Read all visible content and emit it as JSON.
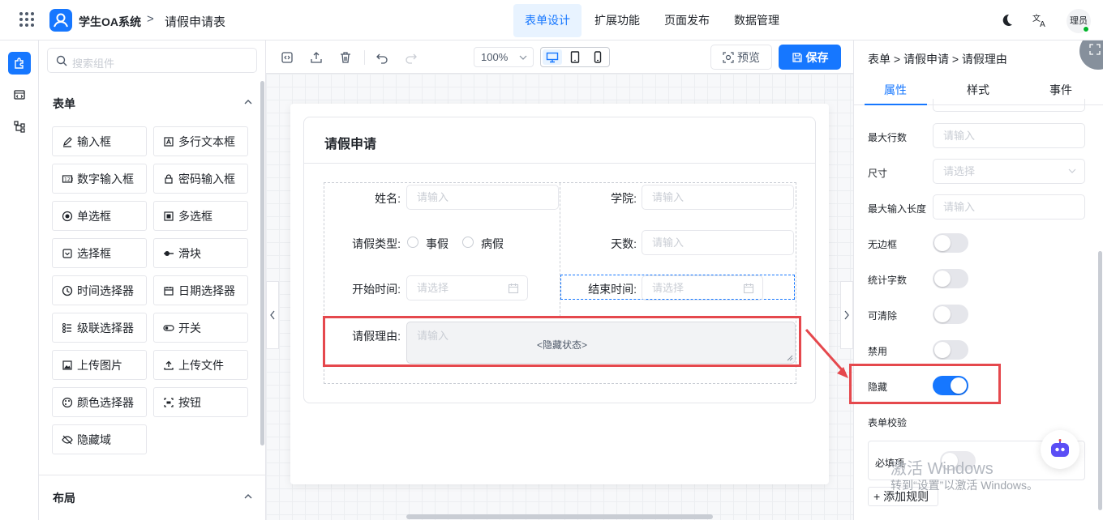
{
  "header": {
    "app_name": "学生OA系统",
    "crumb_sep": ">",
    "form_name": "请假申请表",
    "nav": [
      "表单设计",
      "扩展功能",
      "页面发布",
      "数据管理"
    ],
    "avatar_text": "理员"
  },
  "components": {
    "search_placeholder": "搜索组件",
    "form_section": "表单",
    "layout_section": "布局",
    "items": [
      {
        "label": "输入框",
        "icon": "edit-icon"
      },
      {
        "label": "多行文本框",
        "icon": "textarea-icon"
      },
      {
        "label": "数字输入框",
        "icon": "number-icon"
      },
      {
        "label": "密码输入框",
        "icon": "lock-icon"
      },
      {
        "label": "单选框",
        "icon": "radio-icon"
      },
      {
        "label": "多选框",
        "icon": "checkbox-icon"
      },
      {
        "label": "选择框",
        "icon": "select-icon"
      },
      {
        "label": "滑块",
        "icon": "slider-icon"
      },
      {
        "label": "时间选择器",
        "icon": "clock-icon"
      },
      {
        "label": "日期选择器",
        "icon": "calendar-icon"
      },
      {
        "label": "级联选择器",
        "icon": "cascader-icon"
      },
      {
        "label": "开关",
        "icon": "switch-icon"
      },
      {
        "label": "上传图片",
        "icon": "image-icon"
      },
      {
        "label": "上传文件",
        "icon": "upload-icon"
      },
      {
        "label": "颜色选择器",
        "icon": "palette-icon"
      },
      {
        "label": "按钮",
        "icon": "button-icon"
      },
      {
        "label": "隐藏域",
        "icon": "eye-off-icon"
      }
    ]
  },
  "toolbar": {
    "zoom": "100%",
    "preview": "预览",
    "save": "保存"
  },
  "form": {
    "title": "请假申请",
    "name_label": "姓名:",
    "name_placeholder": "请输入",
    "college_label": "学院:",
    "college_placeholder": "请输入",
    "type_label": "请假类型:",
    "type_options": [
      "事假",
      "病假"
    ],
    "days_label": "天数:",
    "days_placeholder": "请输入",
    "start_label": "开始时间:",
    "start_placeholder": "请选择",
    "end_label": "结束时间:",
    "end_placeholder": "请选择",
    "reason_label": "请假理由:",
    "reason_placeholder": "请输入",
    "hidden_state": "<隐藏状态>"
  },
  "props": {
    "breadcrumb": "表单 > 请假申请 > 请假理由",
    "tabs": [
      "属性",
      "样式",
      "事件"
    ],
    "max_rows_label": "最大行数",
    "max_rows_placeholder": "请输入",
    "size_label": "尺寸",
    "size_placeholder": "请选择",
    "maxlen_label": "最大输入长度",
    "maxlen_placeholder": "请输入",
    "switches": [
      {
        "label": "无边框",
        "on": false
      },
      {
        "label": "统计字数",
        "on": false
      },
      {
        "label": "可清除",
        "on": false
      },
      {
        "label": "禁用",
        "on": false
      },
      {
        "label": "隐藏",
        "on": true
      }
    ],
    "validation_label": "表单校验",
    "required_label": "必填项",
    "add_rule": "+ 添加规则"
  },
  "watermark": {
    "line1": "激活 Windows",
    "line2": "转到“设置”以激活 Windows。"
  },
  "colors": {
    "primary": "#1677ff",
    "highlight": "#e5484d"
  }
}
